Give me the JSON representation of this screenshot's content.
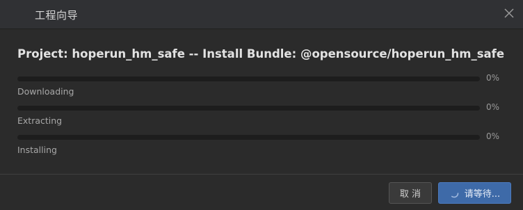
{
  "window": {
    "title": "工程向导"
  },
  "heading": "Project: hoperun_hm_safe -- Install Bundle: @opensource/hoperun_hm_safe",
  "steps": [
    {
      "label": "Downloading",
      "percent_text": "0%",
      "progress": 0
    },
    {
      "label": "Extracting",
      "percent_text": "0%",
      "progress": 0
    },
    {
      "label": "Installing",
      "percent_text": "0%",
      "progress": 0
    }
  ],
  "buttons": {
    "cancel": "取 消",
    "wait": "请等待..."
  },
  "colors": {
    "accent": "#3e6aa8",
    "background": "#2b2b2b",
    "track": "#1d1d1d"
  },
  "icons": {
    "close": "close-icon",
    "spinner": "loading-spinner-icon"
  }
}
